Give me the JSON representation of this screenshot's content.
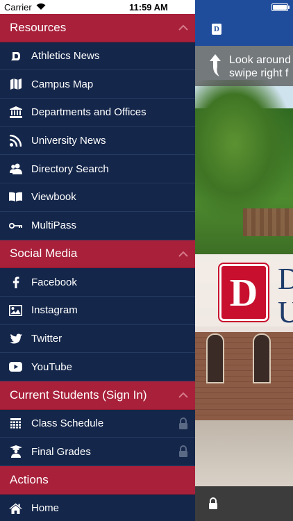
{
  "status_bar": {
    "carrier": "Carrier",
    "time": "11:59 AM"
  },
  "tip": {
    "line1": "Look around",
    "line2": "swipe right f"
  },
  "background_brand": {
    "line1": "D",
    "line2": "U"
  },
  "colors": {
    "section_header": "#a8203a",
    "drawer_bg": "#14264a",
    "top_bar": "#1f4d9c"
  },
  "sections": [
    {
      "title": "Resources",
      "collapsible": true,
      "items": [
        {
          "label": "Athletics News",
          "icon": "athletics-d-icon",
          "locked": false
        },
        {
          "label": "Campus Map",
          "icon": "map-icon",
          "locked": false
        },
        {
          "label": "Departments and Offices",
          "icon": "building-icon",
          "locked": false
        },
        {
          "label": "University News",
          "icon": "rss-icon",
          "locked": false
        },
        {
          "label": "Directory Search",
          "icon": "people-icon",
          "locked": false
        },
        {
          "label": "Viewbook",
          "icon": "book-icon",
          "locked": false
        },
        {
          "label": "MultiPass",
          "icon": "key-icon",
          "locked": false
        }
      ]
    },
    {
      "title": "Social Media",
      "collapsible": true,
      "items": [
        {
          "label": "Facebook",
          "icon": "facebook-icon",
          "locked": false
        },
        {
          "label": "Instagram",
          "icon": "image-icon",
          "locked": false
        },
        {
          "label": "Twitter",
          "icon": "twitter-icon",
          "locked": false
        },
        {
          "label": "YouTube",
          "icon": "youtube-icon",
          "locked": false
        }
      ]
    },
    {
      "title": "Current Students (Sign In)",
      "collapsible": true,
      "items": [
        {
          "label": "Class Schedule",
          "icon": "calendar-grid-icon",
          "locked": true
        },
        {
          "label": "Final Grades",
          "icon": "graduate-icon",
          "locked": true
        }
      ]
    },
    {
      "title": "Actions",
      "collapsible": false,
      "items": [
        {
          "label": "Home",
          "icon": "home-icon",
          "locked": false
        }
      ]
    }
  ]
}
